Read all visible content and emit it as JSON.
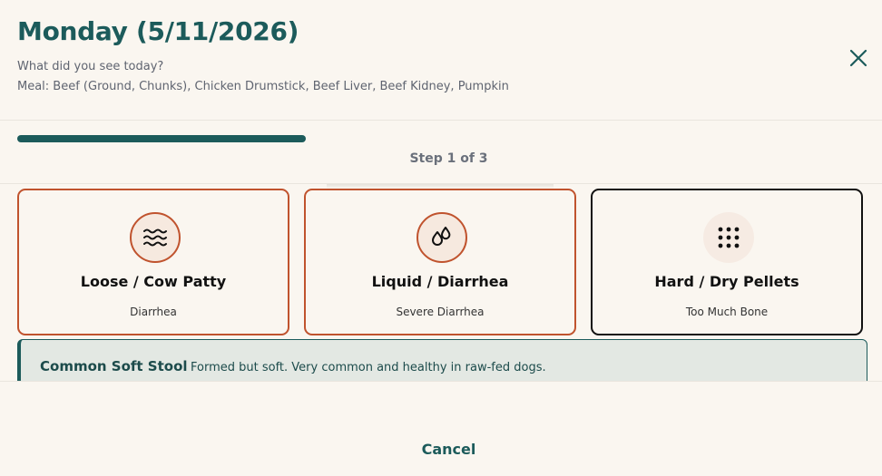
{
  "header": {
    "title": "Monday (5/11/2026)",
    "subtitle": "What did you see today?",
    "meal": "Meal: Beef (Ground, Chunks), Chicken Drumstick, Beef Liver, Beef Kidney, Pumpkin",
    "close_icon": "close-icon"
  },
  "progress": {
    "fraction": 0.34,
    "step_label": "Step 1 of 3"
  },
  "options": [
    {
      "title": "Loose / Cow Patty",
      "subtitle": "Diarrhea",
      "icon": "waves-icon",
      "selected": false
    },
    {
      "title": "Liquid / Diarrhea",
      "subtitle": "Severe Diarrhea",
      "icon": "droplets-icon",
      "selected": false
    },
    {
      "title": "Hard / Dry Pellets",
      "subtitle": "Too Much Bone",
      "icon": "dots-grid-icon",
      "selected": true
    }
  ],
  "info": {
    "title": "Common Soft Stool",
    "description": "Formed but soft. Very common and healthy in raw-fed dogs."
  },
  "footer": {
    "cancel_label": "Cancel"
  },
  "colors": {
    "background": "#faf6f0",
    "primary": "#1c5b5b",
    "accent": "#c0532e",
    "info_background": "#e3e8e3"
  }
}
